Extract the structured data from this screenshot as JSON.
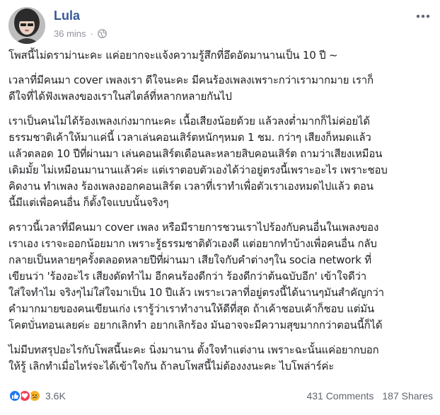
{
  "post": {
    "author": "Lula",
    "time": "36 mins",
    "dot": "·",
    "paragraphs": [
      "โพสนี้ไม่ดราม่านะคะ แค่อยากจะแจ้งความรู้สึกที่อึดอัดมานานเป็น 10 ปี ~",
      "เวลาที่มีคนมา cover เพลงเรา ดีใจนะคะ มีคนร้องเพลงเพราะกว่าเรามากมาย เราก็\nดีใจที่ได้ฟังเพลงของเราในสไตล์ที่หลากหลายกันไป",
      "เราเป็นคนไม่ได้ร้องเพลงเก่งมากนะคะ เนื้อเสียงน้อยด้วย แล้วลงต่ำมากก็ไม่ค่อยได้\nธรรมชาติเค้าให้มาแค่นี้ เวลาเล่นคอนเสิร์ตหนักๆหมด 1 ชม. กว่าๆ เสียงก็หมดแล้ว\nแล้วตลอด 10 ปีที่ผ่านมา เล่นคอนเสิร์ตเดือนละหลายสิบคอนเสิร์ต ถามว่าเสียงเหมือน\nเดิมมั้ย ไม่เหมือนมานานแล้วค่ะ แต่เราตอบตัวเองได้ว่าอยู่ตรงนี้เพราะอะไร เพราะชอบ\nคิดงาน ทำเพลง ร้องเพลงออกคอนเสิร์ต เวลาที่เราทำเพื่อตัวเราเองหมดไปแล้ว ตอน\nนี้มีแต่เพื่อคนอื่น ก็ตั้งใจแบบนั้นจริงๆ",
      "คราวนี้เวลาที่มีคนมา cover เพลง หรือมีรายการชวนเราไปร้องกับคนอื่นในเพลงของ\nเราเอง เราจะออกน้อยมาก เพราะรู้ธรรมชาติตัวเองดี แต่อยากทำบ้างเพื่อคนอื่น กลับ\nกลายเป็นหลายๆครั้งตลอดหลายปีที่ผ่านมา เสียใจกับคำต่างๆใน socia network ที่\nเขียนว่า 'ร้องอะไร เสียงดัดทำไม อีกคนร้องดีกว่า ร้องดีกว่าต้นฉบับอีก' เข้าใจดีว่า\nใส่ใจทำไม จริงๆไม่ใส่ใจมาเป็น 10 ปีแล้ว เพราะเวลาที่อยู่ตรงนี้ได้นานๆมันสำคัญกว่า\nคำมากมายของคนเขียนเก่ง เรารู้ว่าเราทำงานให้ดีที่สุด ถ้าเค้าชอบเค้าก็ชอบ แต่มัน\nโคตบั่นทอนเลยค่ะ อยากเลิกทำ อยากเลิกร้อง มันอาจจะมีความสุขมากกว่าตอนนี้ก็ได้",
      "ไม่มีบทสรุปอะไรกับโพสนี้นะคะ นิ่งมานาน ตั้งใจทำแต่งาน เพราะฉะนั้นแค่อยากบอก\nให้รู้ เลิกทำเมื่อไหร่จะได้เข้าใจกัน ถ้าลบโพสนี้ไม่ต้องงงนะคะ ไบโพล่าร์ค่ะ"
    ],
    "reaction_count": "3.6K",
    "comments": "431 Comments",
    "shares": "187 Shares",
    "icons": {
      "privacy": "globe-icon",
      "menu": "more-options-icon",
      "reactions": [
        "like-reaction-icon",
        "love-reaction-icon",
        "sad-reaction-icon"
      ]
    },
    "colors": {
      "author": "#385898",
      "meta": "#90949c",
      "like": "#2078f4",
      "love": "#f33e58",
      "sad": "#f7b125"
    }
  }
}
